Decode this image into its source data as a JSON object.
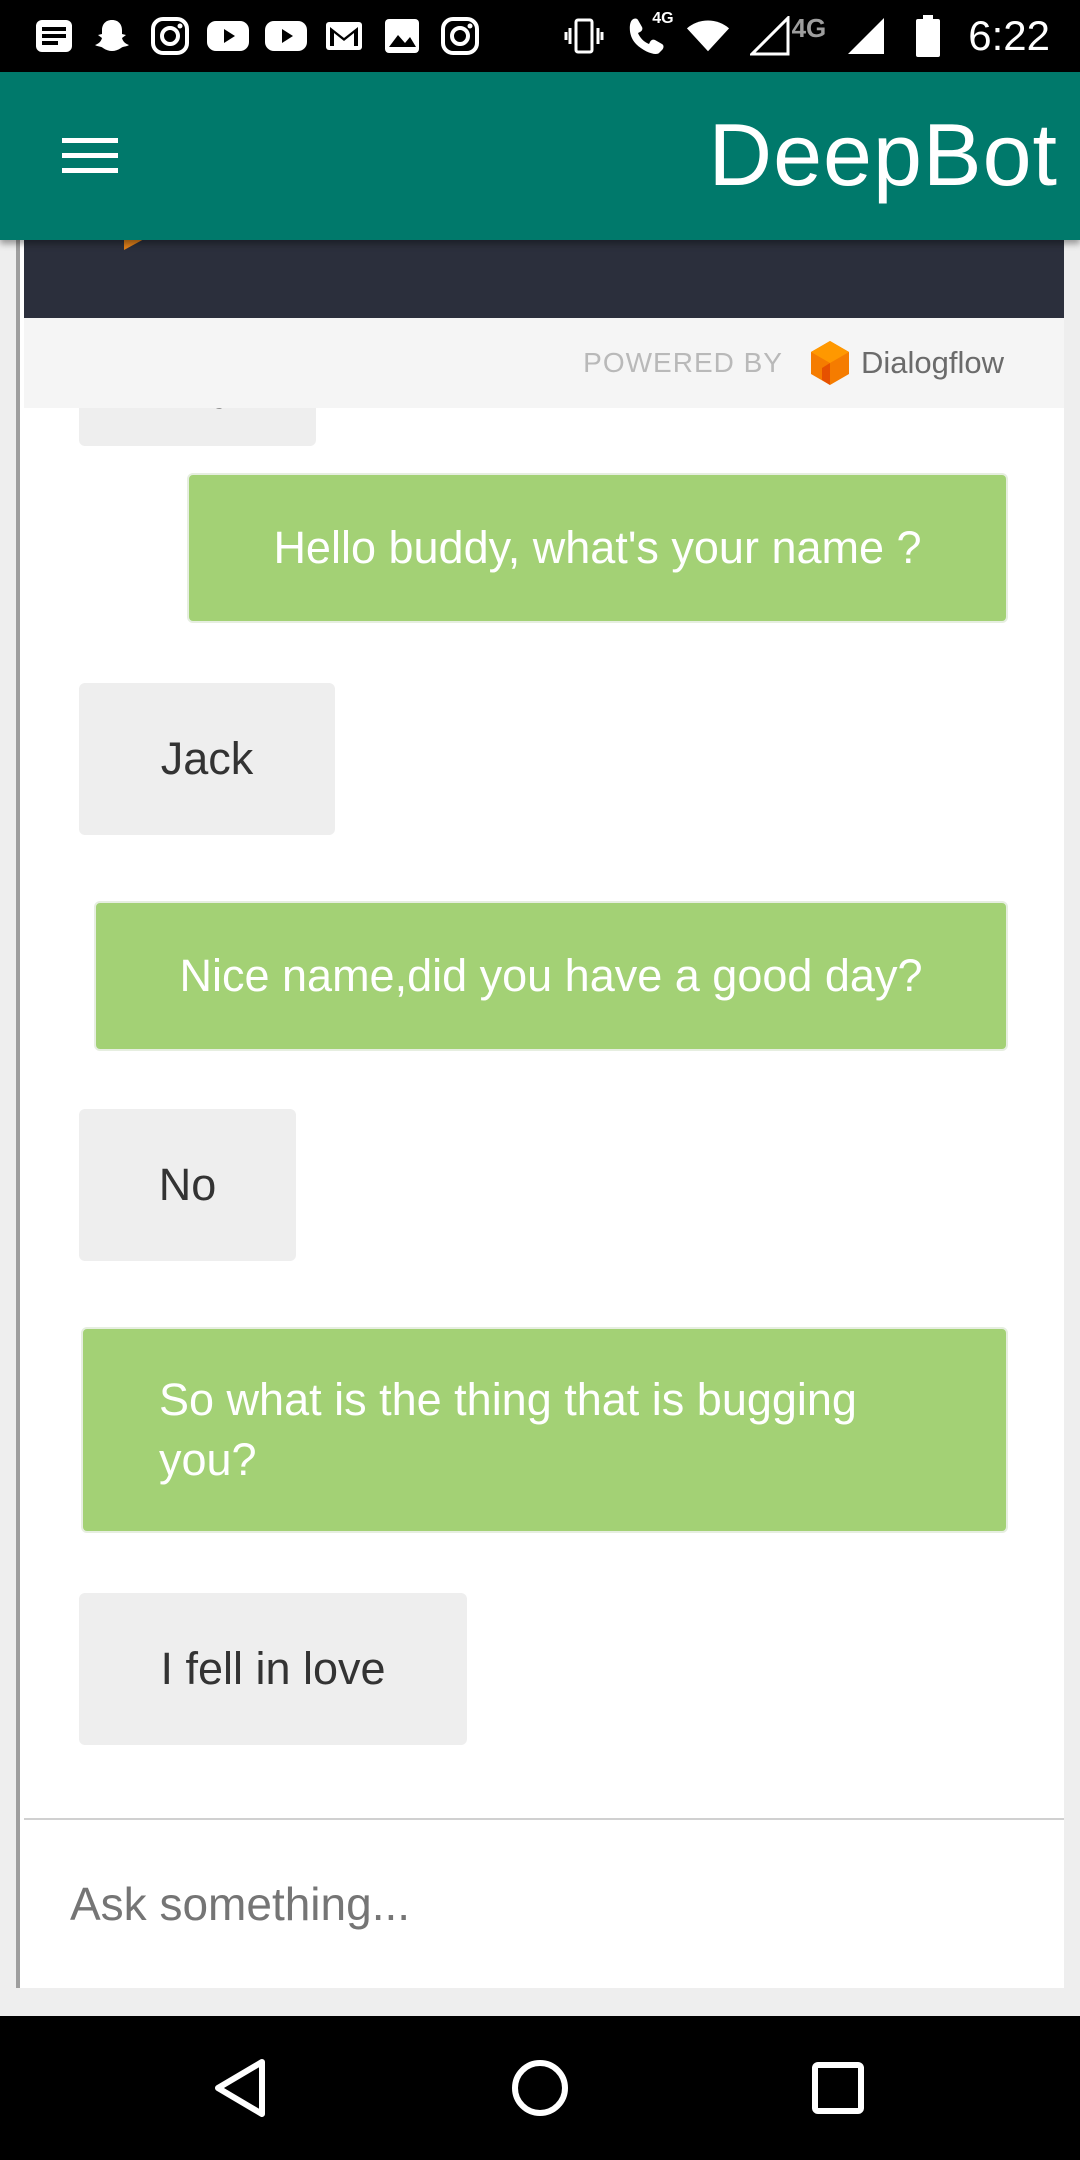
{
  "status_bar": {
    "time": "6:22",
    "network_label": "4G",
    "call_badge": "4G",
    "icons": [
      "notification-icon",
      "snapchat-icon",
      "instagram-icon",
      "youtube-icon",
      "youtube-icon",
      "gmail-icon",
      "gallery-icon",
      "instagram-icon",
      "vibrate-icon",
      "volte-call-icon",
      "wifi-icon",
      "signal-icon",
      "signal-icon",
      "battery-icon"
    ]
  },
  "app_bar": {
    "title": "DeepBot"
  },
  "branding": {
    "powered_by": "POWERED BY",
    "provider": "Dialogflow",
    "logo_color": "#f57c00"
  },
  "messages": [
    {
      "sender": "bot",
      "text": "Hey"
    },
    {
      "sender": "user",
      "text": "Hello buddy, what's your name ?"
    },
    {
      "sender": "bot",
      "text": "Jack"
    },
    {
      "sender": "user",
      "text": "Nice name,did you have a good day?"
    },
    {
      "sender": "bot",
      "text": "No"
    },
    {
      "sender": "user",
      "text": "So what is the thing that is bugging you?"
    },
    {
      "sender": "bot",
      "text": "I fell in love"
    }
  ],
  "input": {
    "placeholder": "Ask something...",
    "value": ""
  },
  "colors": {
    "app_bar": "#00796b",
    "user_bubble": "#a3d175",
    "bot_bubble": "#eeeeee"
  }
}
